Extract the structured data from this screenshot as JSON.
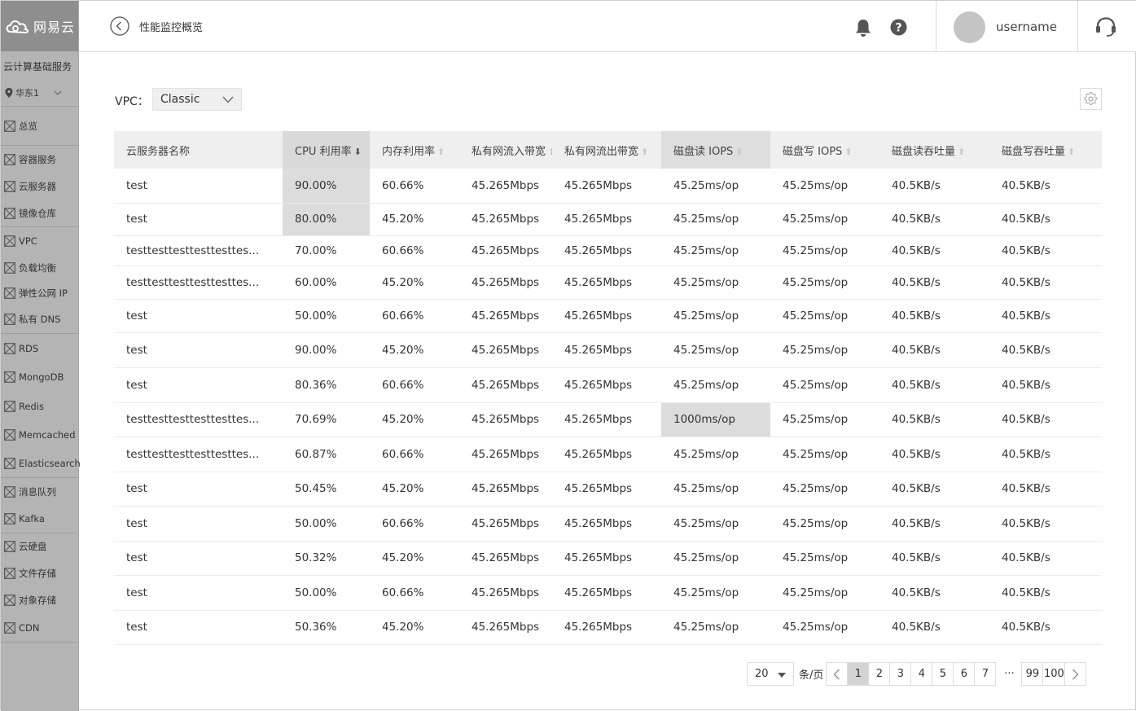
{
  "brand": {
    "name": "网易云"
  },
  "sidebar": {
    "service_title": "云计算基础服务",
    "region": "华东1",
    "groups": [
      {
        "items": [
          {
            "label": "总览"
          }
        ]
      },
      {
        "items": [
          {
            "label": "容器服务"
          },
          {
            "label": "云服务器"
          },
          {
            "label": "镜像仓库"
          }
        ]
      },
      {
        "items": [
          {
            "label": "VPC"
          },
          {
            "label": "负载均衡"
          },
          {
            "label": "弹性公网 IP"
          },
          {
            "label": "私有 DNS"
          }
        ]
      },
      {
        "items": [
          {
            "label": "RDS"
          },
          {
            "label": "MongoDB"
          },
          {
            "label": "Redis"
          },
          {
            "label": "Memcached"
          },
          {
            "label": "Elasticsearch"
          }
        ]
      },
      {
        "items": [
          {
            "label": "消息队列"
          },
          {
            "label": "Kafka"
          }
        ]
      },
      {
        "items": [
          {
            "label": "云硬盘"
          },
          {
            "label": "文件存储"
          },
          {
            "label": "对象存储"
          },
          {
            "label": "CDN"
          }
        ]
      }
    ]
  },
  "header": {
    "title": "性能监控概览",
    "username": "username"
  },
  "filter": {
    "vpc_label": "VPC：",
    "vpc_value": "Classic"
  },
  "table": {
    "columns": [
      {
        "label": "云服务器名称",
        "sort": "none"
      },
      {
        "label": "CPU 利用率",
        "sort": "desc"
      },
      {
        "label": "内存利用率",
        "sort": "asc"
      },
      {
        "label": "私有网流入带宽",
        "sort": "asc"
      },
      {
        "label": "私有网流出带宽",
        "sort": "asc"
      },
      {
        "label": "磁盘读 IOPS",
        "sort": "asc"
      },
      {
        "label": "磁盘写 IOPS",
        "sort": "asc"
      },
      {
        "label": "磁盘读吞吐量",
        "sort": "asc"
      },
      {
        "label": "磁盘写吞吐量",
        "sort": "asc"
      }
    ],
    "rows": [
      [
        "test",
        "90.00%",
        "60.66%",
        "45.265Mbps",
        "45.265Mbps",
        "45.25ms/op",
        "45.25ms/op",
        "40.5KB/s",
        "40.5KB/s"
      ],
      [
        "test",
        "80.00%",
        "45.20%",
        "45.265Mbps",
        "45.265Mbps",
        "45.25ms/op",
        "45.25ms/op",
        "40.5KB/s",
        "40.5KB/s"
      ],
      [
        "testtesttesttesttesttes...",
        "70.00%",
        "60.66%",
        "45.265Mbps",
        "45.265Mbps",
        "45.25ms/op",
        "45.25ms/op",
        "40.5KB/s",
        "40.5KB/s"
      ],
      [
        "testtesttesttesttesttes...",
        "60.00%",
        "45.20%",
        "45.265Mbps",
        "45.265Mbps",
        "45.25ms/op",
        "45.25ms/op",
        "40.5KB/s",
        "40.5KB/s"
      ],
      [
        "test",
        "50.00%",
        "60.66%",
        "45.265Mbps",
        "45.265Mbps",
        "45.25ms/op",
        "45.25ms/op",
        "40.5KB/s",
        "40.5KB/s"
      ],
      [
        "test",
        "90.00%",
        "45.20%",
        "45.265Mbps",
        "45.265Mbps",
        "45.25ms/op",
        "45.25ms/op",
        "40.5KB/s",
        "40.5KB/s"
      ],
      [
        "test",
        "80.36%",
        "60.66%",
        "45.265Mbps",
        "45.265Mbps",
        "45.25ms/op",
        "45.25ms/op",
        "40.5KB/s",
        "40.5KB/s"
      ],
      [
        "testtesttesttesttesttes...",
        "70.69%",
        "45.20%",
        "45.265Mbps",
        "45.265Mbps",
        "1000ms/op",
        "45.25ms/op",
        "40.5KB/s",
        "40.5KB/s"
      ],
      [
        "testtesttesttesttesttes...",
        "60.87%",
        "60.66%",
        "45.265Mbps",
        "45.265Mbps",
        "45.25ms/op",
        "45.25ms/op",
        "40.5KB/s",
        "40.5KB/s"
      ],
      [
        "test",
        "50.45%",
        "45.20%",
        "45.265Mbps",
        "45.265Mbps",
        "45.25ms/op",
        "45.25ms/op",
        "40.5KB/s",
        "40.5KB/s"
      ],
      [
        "test",
        "50.00%",
        "60.66%",
        "45.265Mbps",
        "45.265Mbps",
        "45.25ms/op",
        "45.25ms/op",
        "40.5KB/s",
        "40.5KB/s"
      ],
      [
        "test",
        "50.32%",
        "45.20%",
        "45.265Mbps",
        "45.265Mbps",
        "45.25ms/op",
        "45.25ms/op",
        "40.5KB/s",
        "40.5KB/s"
      ],
      [
        "test",
        "50.00%",
        "60.66%",
        "45.265Mbps",
        "45.265Mbps",
        "45.25ms/op",
        "45.25ms/op",
        "40.5KB/s",
        "40.5KB/s"
      ],
      [
        "test",
        "50.36%",
        "45.20%",
        "45.265Mbps",
        "45.265Mbps",
        "45.25ms/op",
        "45.25ms/op",
        "40.5KB/s",
        "40.5KB/s"
      ]
    ]
  },
  "pagination": {
    "page_size": "20",
    "per_page_label": "条/页",
    "pages": [
      "1",
      "2",
      "3",
      "4",
      "5",
      "6",
      "7"
    ],
    "ellipsis": "···",
    "tail_pages": [
      "99",
      "100"
    ],
    "current": "1"
  },
  "colors": {
    "sidebar_bg": "#b4b4b4",
    "logo_bg": "#8e8e8e",
    "highlight": "#dcdcdc"
  }
}
